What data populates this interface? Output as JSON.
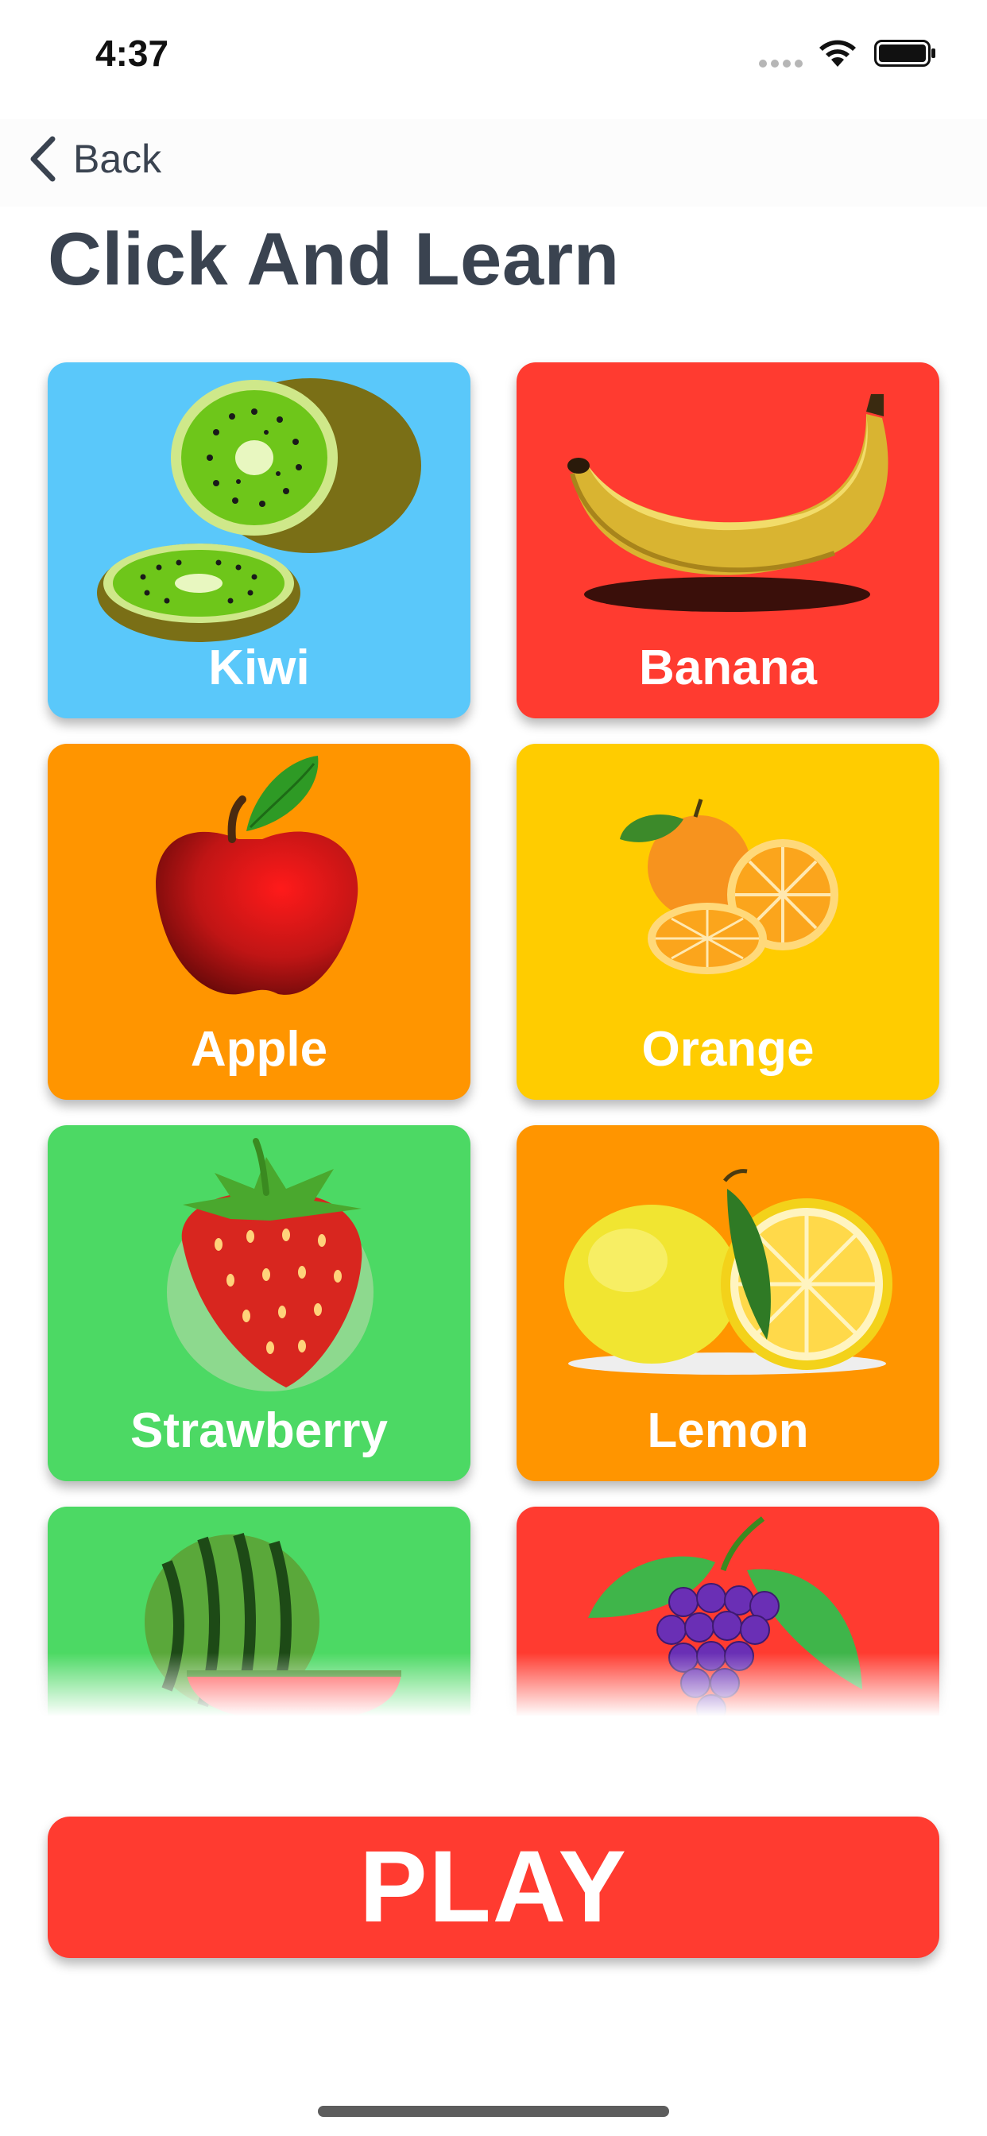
{
  "status_bar": {
    "time": "4:37"
  },
  "nav": {
    "back_label": "Back"
  },
  "title": "Click And Learn",
  "tiles": [
    {
      "label": "Kiwi",
      "color": "#5ac8fa",
      "icon": "kiwi-icon"
    },
    {
      "label": "Banana",
      "color": "#ff3b30",
      "icon": "banana-icon"
    },
    {
      "label": "Apple",
      "color": "#ff9500",
      "icon": "apple-icon"
    },
    {
      "label": "Orange",
      "color": "#ffcc00",
      "icon": "orange-icon"
    },
    {
      "label": "Strawberry",
      "color": "#4cd964",
      "icon": "strawberry-icon"
    },
    {
      "label": "Lemon",
      "color": "#ff9500",
      "icon": "lemon-icon"
    },
    {
      "label": "",
      "color": "#4cd964",
      "icon": "watermelon-icon"
    },
    {
      "label": "",
      "color": "#ff3b30",
      "icon": "grapes-icon"
    }
  ],
  "play_label": "PLAY",
  "colors": {
    "title": "#3a4350",
    "play_button": "#ff3b30"
  }
}
